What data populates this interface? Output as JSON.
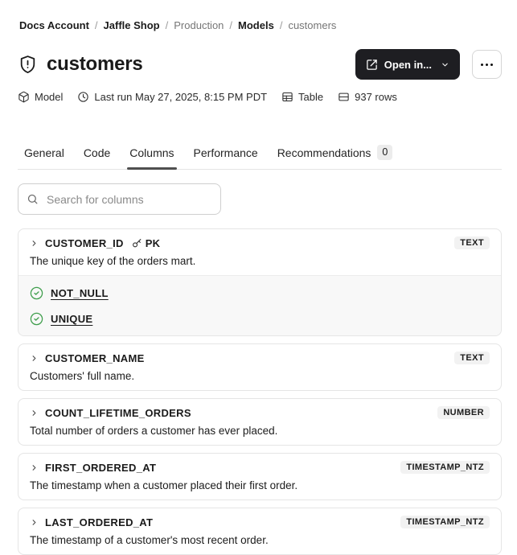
{
  "breadcrumb": {
    "separator": "/",
    "items": [
      {
        "label": "Docs Account",
        "emphasis": true
      },
      {
        "label": "Jaffle Shop",
        "emphasis": true
      },
      {
        "label": "Production",
        "emphasis": false
      },
      {
        "label": "Models",
        "emphasis": true
      },
      {
        "label": "customers",
        "emphasis": false
      }
    ]
  },
  "header": {
    "title": "customers",
    "title_icon": "shield-alert-icon",
    "open_in_label": "Open in..."
  },
  "meta": {
    "items": [
      {
        "icon": "model-icon",
        "label": "Model"
      },
      {
        "icon": "clock-icon",
        "label": "Last run May 27, 2025, 8:15 PM PDT"
      },
      {
        "icon": "table-icon",
        "label": "Table"
      },
      {
        "icon": "rows-icon",
        "label": "937 rows"
      }
    ]
  },
  "tabs": [
    {
      "label": "General"
    },
    {
      "label": "Code"
    },
    {
      "label": "Columns",
      "active": true
    },
    {
      "label": "Performance"
    },
    {
      "label": "Recommendations",
      "badge": "0"
    }
  ],
  "search": {
    "placeholder": "Search for columns"
  },
  "columns": [
    {
      "name": "CUSTOMER_ID",
      "pk": "PK",
      "type": "TEXT",
      "description": "The unique key of the orders mart.",
      "tests": [
        "NOT_NULL",
        "UNIQUE"
      ]
    },
    {
      "name": "CUSTOMER_NAME",
      "type": "TEXT",
      "description": "Customers' full name."
    },
    {
      "name": "COUNT_LIFETIME_ORDERS",
      "type": "NUMBER",
      "description": "Total number of orders a customer has ever placed."
    },
    {
      "name": "FIRST_ORDERED_AT",
      "type": "TIMESTAMP_NTZ",
      "description": "The timestamp when a customer placed their first order."
    },
    {
      "name": "LAST_ORDERED_AT",
      "type": "TIMESTAMP_NTZ",
      "description": "The timestamp of a customer's most recent order."
    }
  ],
  "colors": {
    "accent_button": "#1e1e22",
    "type_badge_bg": "#f2f2f2",
    "tests_section_bg": "#f8f8f8",
    "test_check_green": "#3f9e4c",
    "card_border": "#e5e5e5",
    "active_tab_underline": "#4f4f4f"
  }
}
